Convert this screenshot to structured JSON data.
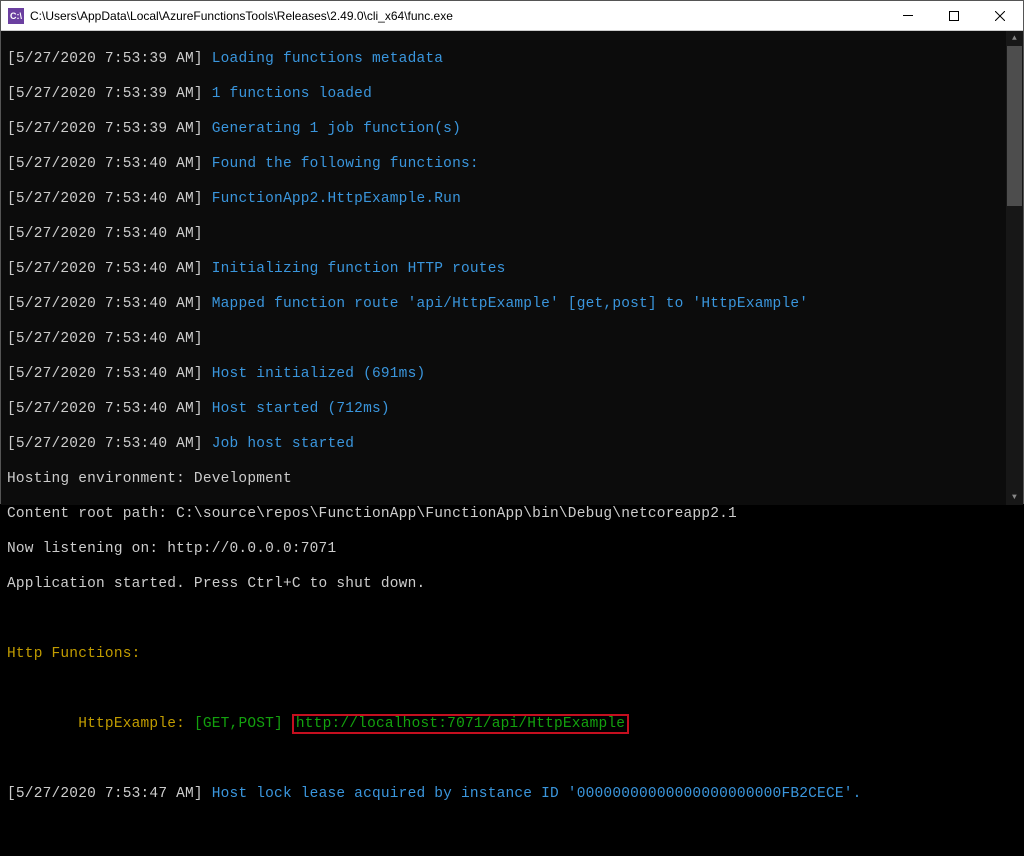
{
  "titlebar": {
    "icon_text": "C:\\",
    "title": "C:\\Users\\AppData\\Local\\AzureFunctionsTools\\Releases\\2.49.0\\cli_x64\\func.exe"
  },
  "lines": [
    {
      "ts": "[5/27/2020 7:53:39 AM]",
      "msg": "Loading functions metadata",
      "msg_class": "msg-cyan"
    },
    {
      "ts": "[5/27/2020 7:53:39 AM]",
      "msg": "1 functions loaded",
      "msg_class": "msg-cyan"
    },
    {
      "ts": "[5/27/2020 7:53:39 AM]",
      "msg": "Generating 1 job function(s)",
      "msg_class": "msg-cyan"
    },
    {
      "ts": "[5/27/2020 7:53:40 AM]",
      "msg": "Found the following functions:",
      "msg_class": "msg-cyan"
    },
    {
      "ts": "[5/27/2020 7:53:40 AM]",
      "msg": "FunctionApp2.HttpExample.Run",
      "msg_class": "msg-cyan"
    },
    {
      "ts": "[5/27/2020 7:53:40 AM]",
      "msg": "",
      "msg_class": "msg-cyan"
    },
    {
      "ts": "[5/27/2020 7:53:40 AM]",
      "msg": "Initializing function HTTP routes",
      "msg_class": "msg-cyan"
    },
    {
      "ts": "[5/27/2020 7:53:40 AM]",
      "msg": "Mapped function route 'api/HttpExample' [get,post] to 'HttpExample'",
      "msg_class": "msg-cyan"
    },
    {
      "ts": "[5/27/2020 7:53:40 AM]",
      "msg": "",
      "msg_class": "msg-cyan"
    },
    {
      "ts": "[5/27/2020 7:53:40 AM]",
      "msg": "Host initialized (691ms)",
      "msg_class": "msg-cyan"
    },
    {
      "ts": "[5/27/2020 7:53:40 AM]",
      "msg": "Host started (712ms)",
      "msg_class": "msg-cyan"
    },
    {
      "ts": "[5/27/2020 7:53:40 AM]",
      "msg": "Job host started",
      "msg_class": "msg-cyan"
    }
  ],
  "plain": {
    "l1": "Hosting environment: Development",
    "l2": "Content root path: C:\\source\\repos\\FunctionApp\\FunctionApp\\bin\\Debug\\netcoreapp2.1",
    "l3": "Now listening on: http://0.0.0.0:7071",
    "l4": "Application started. Press Ctrl+C to shut down."
  },
  "httpfunc": {
    "header": "Http Functions:",
    "indent": "        ",
    "name": "HttpExample: ",
    "methods": "[GET,POST]",
    "url": "http://localhost:7071/api/HttpExample"
  },
  "last": {
    "ts": "[5/27/2020 7:53:47 AM]",
    "msg": "Host lock lease acquired by instance ID '00000000000000000000000FB2CECE'."
  }
}
